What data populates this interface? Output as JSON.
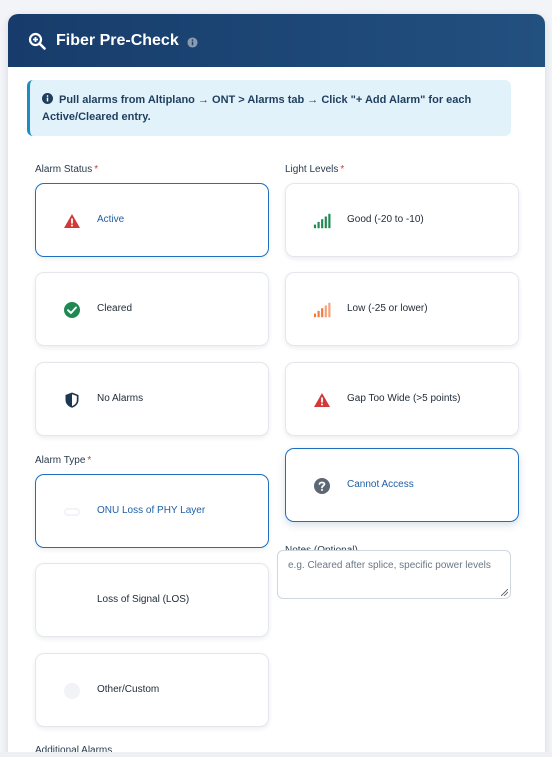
{
  "header": {
    "title": "Fiber Pre-Check"
  },
  "banner": {
    "text": "Pull alarms from Altiplano → ONT > Alarms tab → Click \"+ Add Alarm\" for each Active/Cleared entry."
  },
  "alarm_status": {
    "label": "Alarm Status",
    "required": "*",
    "options": [
      {
        "label": "Active",
        "icon": "warning-triangle-icon",
        "selected": true
      },
      {
        "label": "Cleared",
        "icon": "check-circle-icon",
        "selected": false
      },
      {
        "label": "No Alarms",
        "icon": "shield-icon",
        "selected": false
      }
    ]
  },
  "light_levels": {
    "label": "Light Levels",
    "required": "*",
    "options": [
      {
        "label": "Good (-20 to -10)",
        "icon": "signal-bars-green-icon",
        "selected": false
      },
      {
        "label": "Low (-25 or lower)",
        "icon": "signal-bars-orange-icon",
        "selected": false
      },
      {
        "label": "Gap Too Wide (>5 points)",
        "icon": "warning-triangle-icon",
        "selected": false
      },
      {
        "label": "Cannot Access",
        "icon": "question-circle-icon",
        "selected": true
      }
    ]
  },
  "alarm_type": {
    "label": "Alarm Type",
    "required": "*",
    "options": [
      {
        "label": "ONU Loss of PHY Layer",
        "icon": "onu-icon",
        "selected": true
      },
      {
        "label": "Loss of Signal (LOS)",
        "icon": "signal-icon",
        "selected": false
      },
      {
        "label": "Other/Custom",
        "icon": "circle-icon",
        "selected": false
      }
    ]
  },
  "notes": {
    "label": "Notes (Optional)",
    "placeholder": "e.g. Cleared after splice, specific power levels"
  },
  "additional_alarms": {
    "label": "Additional Alarms"
  },
  "colors": {
    "header_bg": "#1b4574",
    "accent": "#1e6fbf",
    "danger": "#d23a3a",
    "success": "#1e8a52",
    "warning": "#f07b3c"
  }
}
